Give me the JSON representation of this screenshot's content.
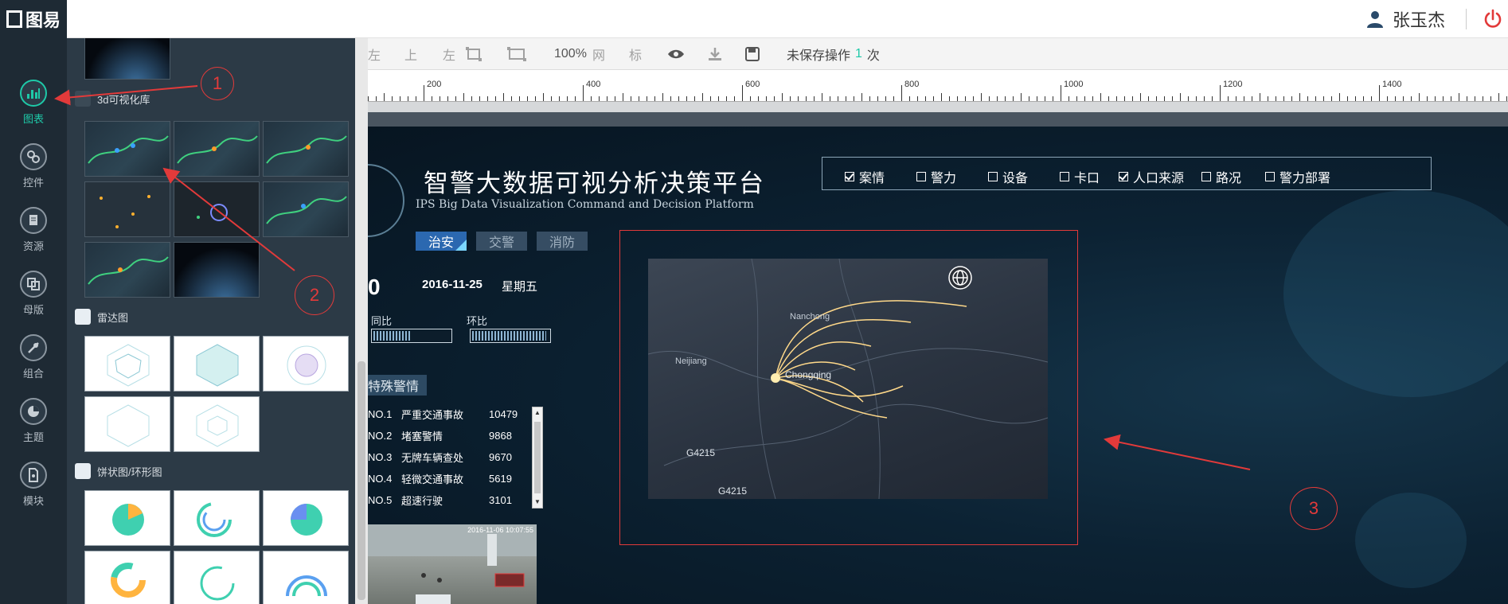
{
  "app": {
    "logo_text": "图易"
  },
  "header": {
    "user_name": "张玉杰"
  },
  "leftnav": {
    "items": [
      {
        "label": "图表",
        "icon": "bar-chart-icon",
        "active": true
      },
      {
        "label": "控件",
        "icon": "link-icon"
      },
      {
        "label": "资源",
        "icon": "book-icon"
      },
      {
        "label": "母版",
        "icon": "copy-icon"
      },
      {
        "label": "组合",
        "icon": "pin-icon"
      },
      {
        "label": "主题",
        "icon": "pie-icon"
      },
      {
        "label": "模块",
        "icon": "file-icon"
      }
    ]
  },
  "library": {
    "sections": [
      {
        "title": "3d可视化库"
      },
      {
        "title": "雷达图"
      },
      {
        "title": "饼状图/环形图"
      }
    ]
  },
  "toolbar": {
    "items": [
      "左",
      "上",
      "左",
      "100%",
      "网",
      "标"
    ],
    "unsaved_prefix": "未保存操作",
    "unsaved_count": "1",
    "unsaved_suffix": "次"
  },
  "ruler": {
    "labels": [
      "200",
      "400",
      "600",
      "800",
      "1000",
      "1200",
      "1400"
    ]
  },
  "dashboard": {
    "title_cn": "智警大数据可视分析决策平台",
    "title_en": "IPS Big Data Visualization Command and Decision Platform",
    "filters": [
      {
        "label": "案情",
        "checked": true
      },
      {
        "label": "警力",
        "checked": false
      },
      {
        "label": "设备",
        "checked": false
      },
      {
        "label": "卡口",
        "checked": false
      },
      {
        "label": "人口来源",
        "checked": true
      },
      {
        "label": "路况",
        "checked": false
      },
      {
        "label": "警力部署",
        "checked": false
      }
    ],
    "tabs": [
      "治安",
      "交警",
      "消防"
    ],
    "big_number_fragment": "0",
    "date": "2016-11-25",
    "weekday": "星期五",
    "yoy_label": "同比",
    "mom_label": "环比",
    "yoy_fill": 0.5,
    "mom_fill": 0.97,
    "alert_title": "特殊警情",
    "alerts": [
      {
        "no": "NO.1",
        "name": "严重交通事故",
        "count": "10479"
      },
      {
        "no": "NO.2",
        "name": "堵塞警情",
        "count": "9868"
      },
      {
        "no": "NO.3",
        "name": "无牌车辆查处",
        "count": "9670"
      },
      {
        "no": "NO.4",
        "name": "轻微交通事故",
        "count": "5619"
      },
      {
        "no": "NO.5",
        "name": "超速行驶",
        "count": "3101"
      }
    ],
    "cctv_timestamp": "2016-11-06 10:07:55",
    "map_labels": [
      "Nanchong",
      "Neijiang",
      "Chongqing",
      "G4215",
      "G4215"
    ]
  },
  "annotations": [
    "1",
    "2",
    "3"
  ],
  "colors": {
    "accent": "#1ec9a8",
    "annotation": "#e23a3a",
    "logout": "#e23a3a",
    "user_icon": "#2a4a6a"
  }
}
